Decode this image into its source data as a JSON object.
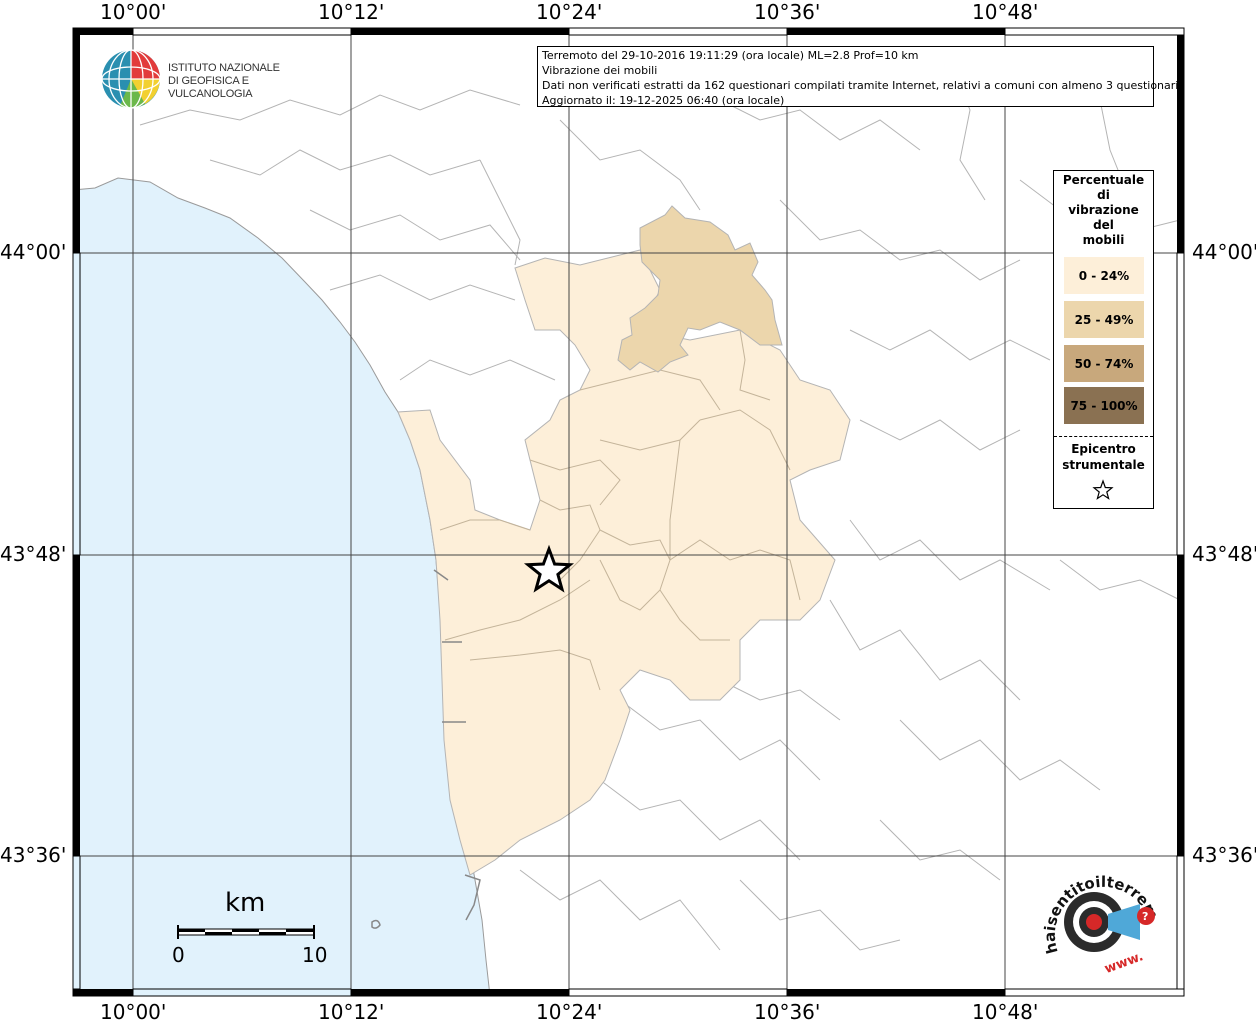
{
  "map": {
    "lon_ticks": [
      "10°00'",
      "10°12'",
      "10°24'",
      "10°36'",
      "10°48'"
    ],
    "lat_ticks": [
      "44°00'",
      "43°48'",
      "43°36'"
    ]
  },
  "info": {
    "line1": "Terremoto del 29-10-2016 19:11:29 (ora locale) ML=2.8 Prof=10 km",
    "line2": "Vibrazione dei mobili",
    "line3": "Dati non verificati estratti da 162 questionari compilati tramite Internet, relativi a comuni con almeno 3 questionari.",
    "line4": "Aggiornato il: 19-12-2025 06:40 (ora locale)"
  },
  "legend": {
    "title_lines": [
      "Percentuale",
      "di",
      "vibrazione",
      "del",
      "mobili"
    ],
    "classes": [
      {
        "label": "0 - 24%",
        "color": "#fdefd9"
      },
      {
        "label": "25 - 49%",
        "color": "#ecd6ac"
      },
      {
        "label": "50 - 74%",
        "color": "#c8a87c"
      },
      {
        "label": "75 - 100%",
        "color": "#8a7152"
      }
    ],
    "epicenter_lines": [
      "Epicentro",
      "strumentale"
    ],
    "epicenter_icon": "star-icon"
  },
  "logo": {
    "line1": "ISTITUTO NAZIONALE",
    "line2": "DI GEOFISICA E VULCANOLOGIA"
  },
  "scale": {
    "unit": "km",
    "min": "0",
    "max": "10"
  },
  "site_logo": {
    "text": "haisentitoilterremoto.it",
    "www": "www."
  },
  "colors": {
    "sea": "#e1f2fc",
    "class_0_24": "#fdefd9",
    "class_25_49": "#ecd6ac",
    "borders": "#b4b4b4"
  }
}
